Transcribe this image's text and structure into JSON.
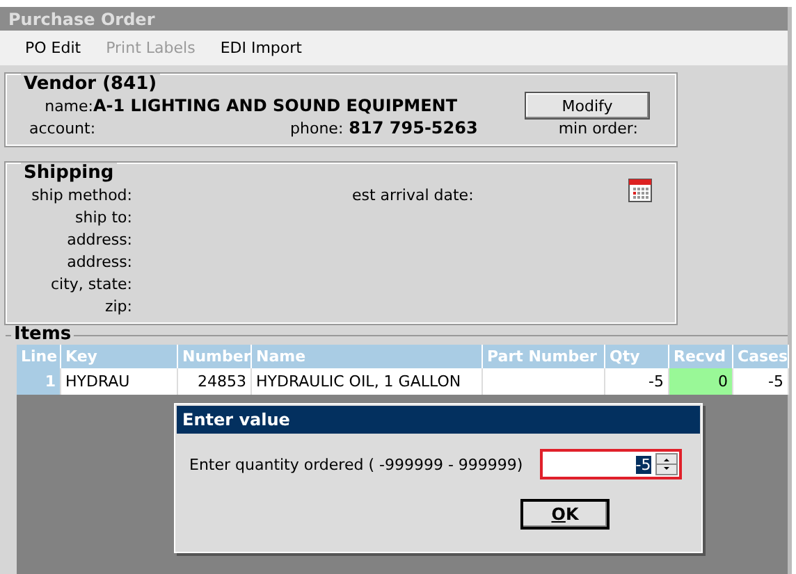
{
  "window": {
    "title": "Purchase Order"
  },
  "menu": [
    {
      "label": "PO Edit",
      "disabled": false
    },
    {
      "label": "Print Labels",
      "disabled": true
    },
    {
      "label": "EDI Import",
      "disabled": false
    }
  ],
  "vendor": {
    "title": "Vendor (841)",
    "name_label": "name:",
    "name": "A-1 LIGHTING AND SOUND EQUIPMENT",
    "account_label": "account:",
    "phone_label": "phone:",
    "phone": "817 795-5263",
    "min_order_label": "min order:",
    "modify_button": "Modify"
  },
  "shipping": {
    "title": "Shipping",
    "labels": [
      "ship method:",
      "ship to:",
      "address:",
      "address:",
      "city, state:",
      "zip:"
    ],
    "est_arrival_label": "est arrival date:"
  },
  "items": {
    "title": "Items",
    "columns": [
      "Line",
      "Key",
      "Number",
      "Name",
      "Part Number",
      "Qty",
      "Recvd",
      "Cases"
    ],
    "rows": [
      {
        "cells": [
          {
            "text": "1"
          },
          {
            "text": "HYDRAU"
          },
          {
            "text": "24853"
          },
          {
            "text": "HYDRAULIC OIL, 1 GALLON"
          },
          {},
          {
            "text": "-5"
          },
          {
            "text": "0",
            "color": "#99f897"
          },
          {
            "text": "-5"
          }
        ]
      }
    ]
  },
  "dialog": {
    "title": "Enter value",
    "prompt": "Enter quantity ordered ( -999999 - 999999)",
    "value": "-5",
    "ok_button": "OK"
  }
}
